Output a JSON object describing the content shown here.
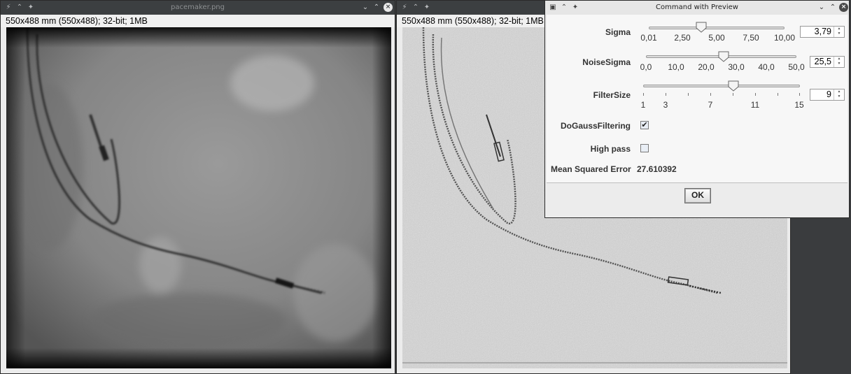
{
  "left_window": {
    "title": "pacemaker.png",
    "info": "550x488 mm (550x488); 32-bit; 1MB"
  },
  "right_window": {
    "title": "",
    "info": "550x488 mm (550x488); 32-bit; 1MB"
  },
  "dialog": {
    "title": "Command with Preview",
    "sigma": {
      "label": "Sigma",
      "value": "3,79",
      "ticks": [
        "0,01",
        "2,50",
        "5,00",
        "7,50",
        "10,00"
      ],
      "position": 0.379
    },
    "noise_sigma": {
      "label": "NoiseSigma",
      "value": "25,5",
      "ticks": [
        "0,0",
        "10,0",
        "20,0",
        "30,0",
        "40,0",
        "50,0"
      ],
      "position": 0.51
    },
    "filter_size": {
      "label": "FilterSize",
      "value": "9",
      "ticks": [
        "1",
        "3",
        "7",
        "11",
        "15"
      ],
      "position": 0.571
    },
    "do_gauss_filtering": {
      "label": "DoGaussFiltering",
      "checked": true,
      "check_glyph": "✔"
    },
    "high_pass": {
      "label": "High pass",
      "checked": false
    },
    "mse": {
      "label": "Mean Squared Error",
      "value": "27.610392"
    },
    "ok_label": "OK"
  },
  "icons": {
    "app": "imagej-icon",
    "shade": "shade-icon",
    "pin": "pin-icon",
    "minimize": "chevron-down-icon",
    "maximize": "chevron-up-icon",
    "close": "close-icon"
  },
  "colors": {
    "titlebar_dark": "#3c3f41",
    "dialog_titlebar": "#e6e6e6",
    "panel_bg": "#f7f7f7"
  }
}
